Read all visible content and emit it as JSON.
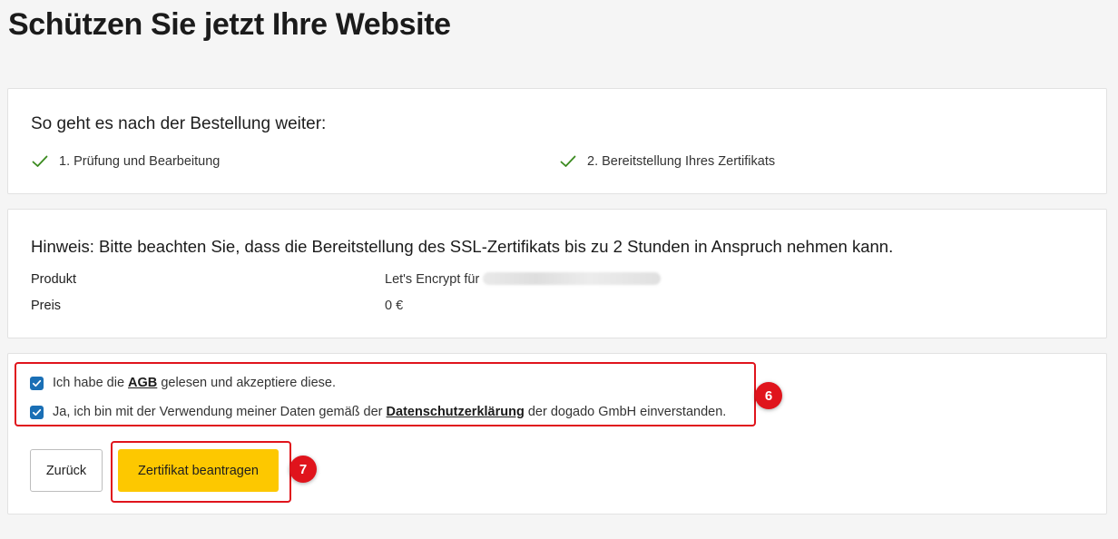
{
  "page": {
    "title": "Schützen Sie jetzt Ihre Website"
  },
  "steps_card": {
    "heading": "So geht es nach der Bestellung weiter:",
    "steps": [
      {
        "label": "1. Prüfung und Bearbeitung",
        "icon": "check-icon"
      },
      {
        "label": "2. Bereitstellung Ihres Zertifikats",
        "icon": "check-icon"
      }
    ],
    "check_color": "#3a8a1e"
  },
  "info_card": {
    "notice": "Hinweis: Bitte beachten Sie, dass die Bereitstellung des SSL-Zertifikats bis zu 2 Stunden in Anspruch nehmen kann.",
    "rows": [
      {
        "label": "Produkt",
        "value": "Let's Encrypt für"
      },
      {
        "label": "Preis",
        "value": "0 €"
      }
    ]
  },
  "confirm_card": {
    "checkboxes": [
      {
        "checked": true,
        "text_before": "Ich habe die",
        "link": "AGB",
        "text_after": "gelesen und akzeptiere diese."
      },
      {
        "checked": true,
        "text_before": "Ja, ich bin mit der Verwendung meiner Daten gemäß der",
        "link": "Datenschutzerklärung",
        "text_after": "der dogado GmbH einverstanden."
      }
    ],
    "back_button": "Zurück",
    "submit_button": "Zertifikat beantragen"
  },
  "annotations": [
    {
      "number": "6"
    },
    {
      "number": "7"
    }
  ],
  "colors": {
    "accent_button": "#fdc800",
    "checkbox": "#1a6fb5",
    "highlight": "#e0141c",
    "background": "#f5f5f5"
  }
}
